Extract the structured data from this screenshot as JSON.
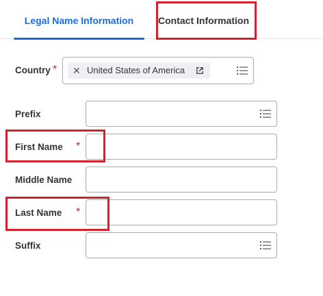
{
  "tabs": [
    {
      "label": "Legal Name Information",
      "active": true
    },
    {
      "label": "Contact Information",
      "active": false
    }
  ],
  "fields": {
    "country": {
      "label": "Country",
      "required": "*",
      "value": "United States of America"
    },
    "prefix": {
      "label": "Prefix",
      "value": ""
    },
    "first_name": {
      "label": "First Name",
      "required": "*",
      "value": ""
    },
    "middle_name": {
      "label": "Middle Name",
      "value": ""
    },
    "last_name": {
      "label": "Last Name",
      "required": "*",
      "value": ""
    },
    "suffix": {
      "label": "Suffix",
      "value": ""
    }
  },
  "icons": {
    "remove": "close-icon",
    "external": "external-link-icon",
    "list": "list-prompt-icon"
  },
  "colors": {
    "accent": "#1f6bd6",
    "required": "#d2222d",
    "highlight": "#d2222d",
    "border": "#a6acb3"
  }
}
